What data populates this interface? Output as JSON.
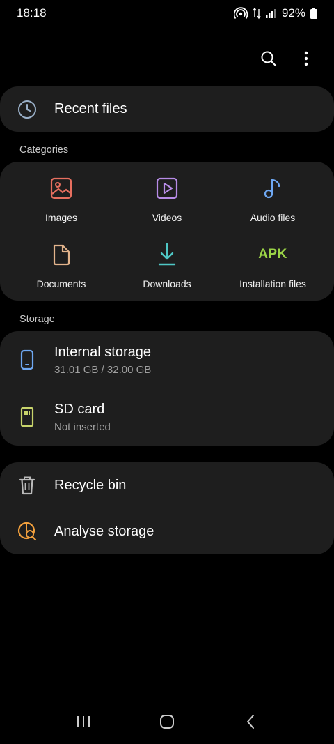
{
  "status": {
    "time": "18:18",
    "battery": "92%"
  },
  "recent": {
    "label": "Recent files"
  },
  "categories": {
    "title": "Categories",
    "items": [
      {
        "label": "Images",
        "icon": "image-icon",
        "color": "#e76f5f"
      },
      {
        "label": "Videos",
        "icon": "video-icon",
        "color": "#b78be6"
      },
      {
        "label": "Audio files",
        "icon": "music-note-icon",
        "color": "#6fa8f2"
      },
      {
        "label": "Documents",
        "icon": "document-icon",
        "color": "#e3b48c"
      },
      {
        "label": "Downloads",
        "icon": "download-icon",
        "color": "#4fc7c5"
      },
      {
        "label": "Installation files",
        "icon": "apk-icon",
        "color": "#9bd447",
        "icon_text": "APK"
      }
    ]
  },
  "storage": {
    "title": "Storage",
    "internal": {
      "label": "Internal storage",
      "detail": "31.01 GB / 32.00 GB",
      "icon": "phone-icon",
      "color": "#6fa8f2"
    },
    "sd": {
      "label": "SD card",
      "detail": "Not inserted",
      "icon": "sd-card-icon",
      "color": "#c8d46b"
    }
  },
  "misc": {
    "recycle": {
      "label": "Recycle bin",
      "icon": "trash-icon"
    },
    "analyse": {
      "label": "Analyse storage",
      "icon": "analyse-storage-icon",
      "color": "#f2a03d"
    }
  }
}
